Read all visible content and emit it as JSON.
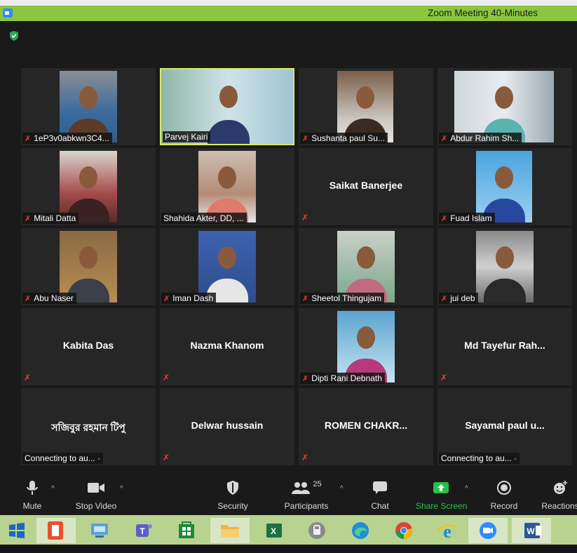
{
  "window": {
    "title": "Zoom Meeting 40-Minutes"
  },
  "tiles": [
    {
      "name": "1eP3v0abkwn3C4...",
      "muted": true
    },
    {
      "name": "Parvej Kairi",
      "muted": false
    },
    {
      "name": "Sushanta paul Su...",
      "muted": true
    },
    {
      "name": "Abdur Rahim Sh...",
      "muted": true
    },
    {
      "name": "Mitali Datta",
      "muted": true
    },
    {
      "name": "Shahida Akter, DD, ...",
      "muted": false
    },
    {
      "center": "Saikat Banerjee",
      "muted": true
    },
    {
      "name": "Fuad Islam",
      "muted": true
    },
    {
      "name": "Abu Naser",
      "muted": true
    },
    {
      "name": "Iman Dash",
      "muted": true
    },
    {
      "name": "Sheetol Thingujam",
      "muted": true
    },
    {
      "name": "jui deb",
      "muted": true
    },
    {
      "center": "Kabita Das",
      "muted": true
    },
    {
      "center": "Nazma Khanom",
      "muted": true
    },
    {
      "name": "Dipti Rani Debnath",
      "muted": true
    },
    {
      "center": "Md Tayefur Rah...",
      "muted": true
    },
    {
      "center": "সজিবুর রহমান টিপু",
      "status": "Connecting to au... ·",
      "muted": false
    },
    {
      "center": "Delwar hussain",
      "muted": true
    },
    {
      "center": "ROMEN CHAKR...",
      "muted": true
    },
    {
      "center": "Sayamal paul u...",
      "status": "Connecting to au... ·",
      "muted": false
    }
  ],
  "toolbar": {
    "mute": "Mute",
    "stop_video": "Stop Video",
    "security": "Security",
    "participants": "Participants",
    "participants_count": "25",
    "chat": "Chat",
    "share_screen": "Share Screen",
    "record": "Record",
    "reactions": "Reactions"
  },
  "colors": {
    "titlebar": "#8cc63f",
    "active_border": "#d7e86b",
    "muted": "#e8413b",
    "share_green": "#27c24c",
    "taskbar": "#b7d38f"
  }
}
